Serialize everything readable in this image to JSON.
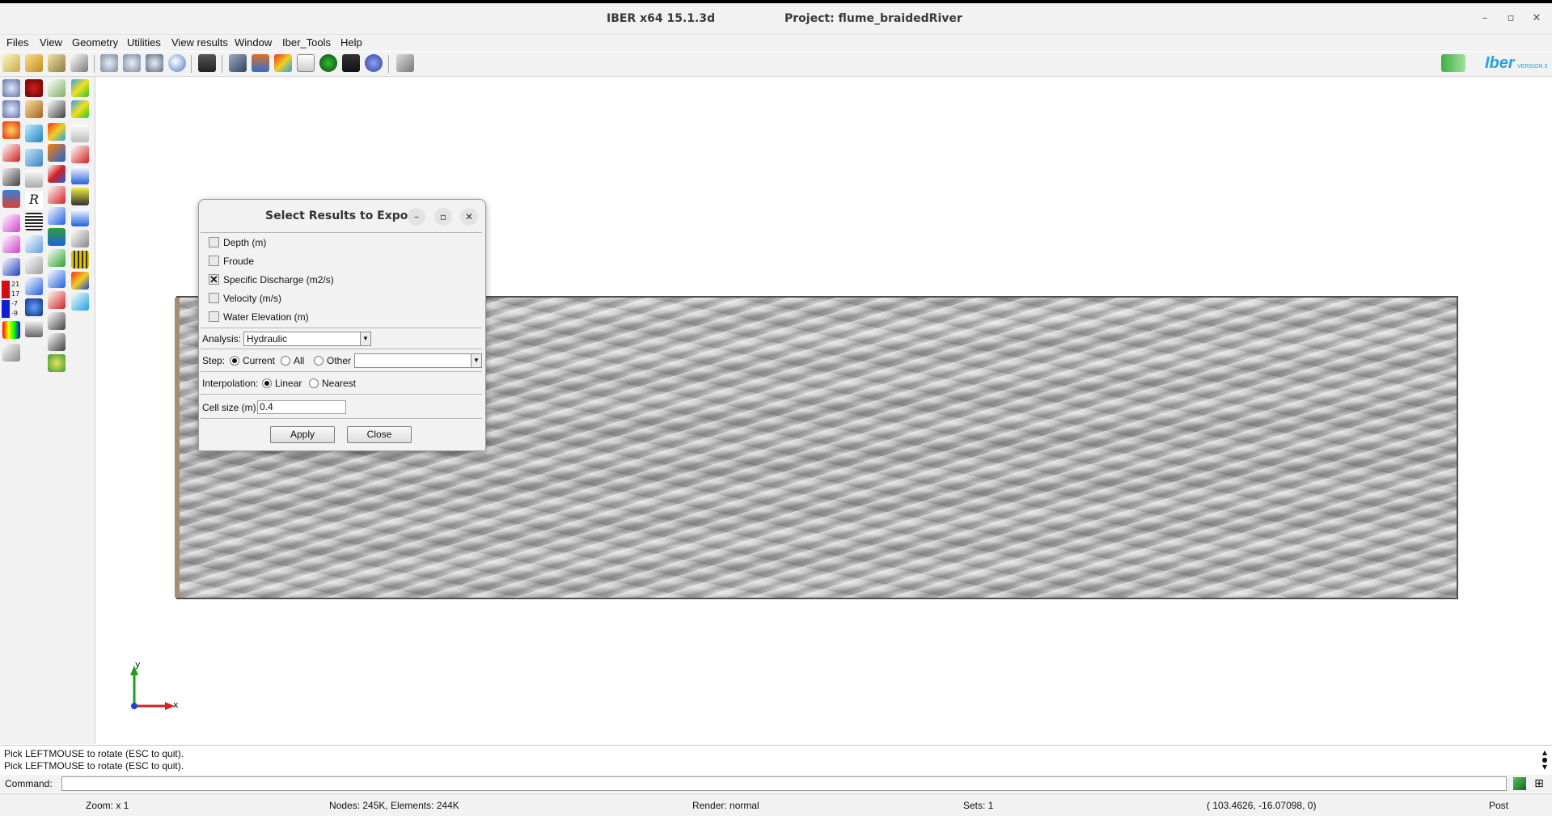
{
  "window": {
    "app_title": "IBER x64 15.1.3d",
    "project_title": "Project: flume_braidedRiver",
    "minimize_glyph": "–",
    "maximize_glyph": "▫",
    "close_glyph": "✕"
  },
  "menu": [
    "Files",
    "View",
    "Geometry",
    "Utilities",
    "View results",
    "Window",
    "Iber_Tools",
    "Help"
  ],
  "toolbar": {
    "icons": [
      "new-file-icon",
      "open-folder-icon",
      "save-icon",
      "save-as-icon",
      "rotate-icon",
      "rotate-screen-icon",
      "rotate-center-icon",
      "sphere-icon",
      "camera-icon",
      "layers-icon",
      "layers-stack-icon",
      "contour-fill-icon",
      "graph-icon",
      "animation-icon",
      "movie-icon",
      "play-icon",
      "pencil-tool-icon"
    ],
    "logo_text": "Iber",
    "logo_subtext": "VERSION 3"
  },
  "lefttools": {
    "legend_numbers": [
      "21",
      "17",
      "-7",
      "-9"
    ]
  },
  "dialog": {
    "title": "Select Results to Export",
    "results": [
      {
        "label": "Depth (m)",
        "checked": false
      },
      {
        "label": "Froude",
        "checked": false
      },
      {
        "label": "Specific Discharge (m2/s)",
        "checked": true
      },
      {
        "label": "Velocity (m/s)",
        "checked": false
      },
      {
        "label": "Water Elevation (m)",
        "checked": false
      }
    ],
    "check_mark": "✕",
    "analysis_label": "Analysis:",
    "analysis_value": "Hydraulic",
    "step_label": "Step:",
    "step_options": {
      "current": "Current",
      "all": "All",
      "other": "Other"
    },
    "step_selected": "Current",
    "step_other_value": "",
    "interpolation_label": "Interpolation:",
    "interpolation_options": {
      "linear": "Linear",
      "nearest": "Nearest"
    },
    "interpolation_selected": "Linear",
    "cellsize_label": "Cell size (m)",
    "cellsize_value": "0.4",
    "apply_label": "Apply",
    "close_label": "Close",
    "dropdown_arrow": "▼"
  },
  "axes": {
    "y_label": "y",
    "x_label": "x"
  },
  "console": {
    "lines": [
      "Pick LEFTMOUSE to rotate (ESC to quit).",
      "Pick LEFTMOUSE to rotate (ESC to quit)."
    ]
  },
  "command": {
    "label": "Command:",
    "value": ""
  },
  "status": {
    "zoom": "Zoom: x 1",
    "nodes": "Nodes: 245K, Elements: 244K",
    "render": "Render: normal",
    "sets": "Sets: 1",
    "coords": "( 103.4626, -16.07098,  0)",
    "mode": "Post"
  }
}
